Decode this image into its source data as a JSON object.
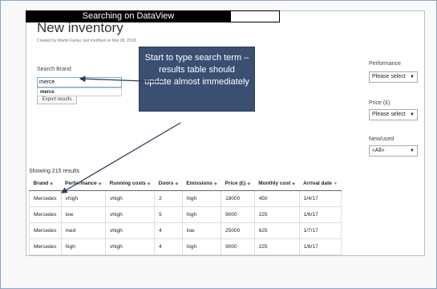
{
  "banner": {
    "text": "Searching on DataView"
  },
  "page": {
    "title": "New inventory",
    "meta": "Created by Martin Farley, last modified on Mar 08, 2018"
  },
  "search": {
    "label": "Search Brand",
    "value": "merce",
    "suggestion": "merce",
    "export_label": "Export results"
  },
  "filters": [
    {
      "label": "Performance",
      "value": "Please select"
    },
    {
      "label": "Price (£)",
      "value": "Please select"
    },
    {
      "label": "New/used",
      "value": "«All»"
    }
  ],
  "tooltip": {
    "text": "Start to type search term – results table should update almost immediately"
  },
  "results": {
    "summary": "Showing 215 results",
    "columns": [
      "Brand",
      "Performance",
      "Running costs",
      "Doors",
      "Emissions",
      "Price (£)",
      "Monthly cost",
      "Arrival date"
    ],
    "rows": [
      [
        "Mercedes",
        "vhigh",
        "vhigh",
        "2",
        "high",
        "18000",
        "450",
        "1/4/17"
      ],
      [
        "Mercedes",
        "low",
        "vhigh",
        "5",
        "high",
        "9000",
        "225",
        "1/6/17"
      ],
      [
        "Mercedes",
        "med",
        "vhigh",
        "4",
        "low",
        "25000",
        "625",
        "1/7/17"
      ],
      [
        "Mercedes",
        "high",
        "vhigh",
        "4",
        "high",
        "9000",
        "225",
        "1/8/17"
      ]
    ]
  },
  "colors": {
    "tooltip_bg": "#3a4f72",
    "slide_border": "#8aa6cc",
    "input_border": "#7aa7d6"
  },
  "icons": {
    "sort": "sort-arrows-icon",
    "sort_desc": "sort-desc-icon",
    "dropdown": "chevron-down-icon"
  }
}
